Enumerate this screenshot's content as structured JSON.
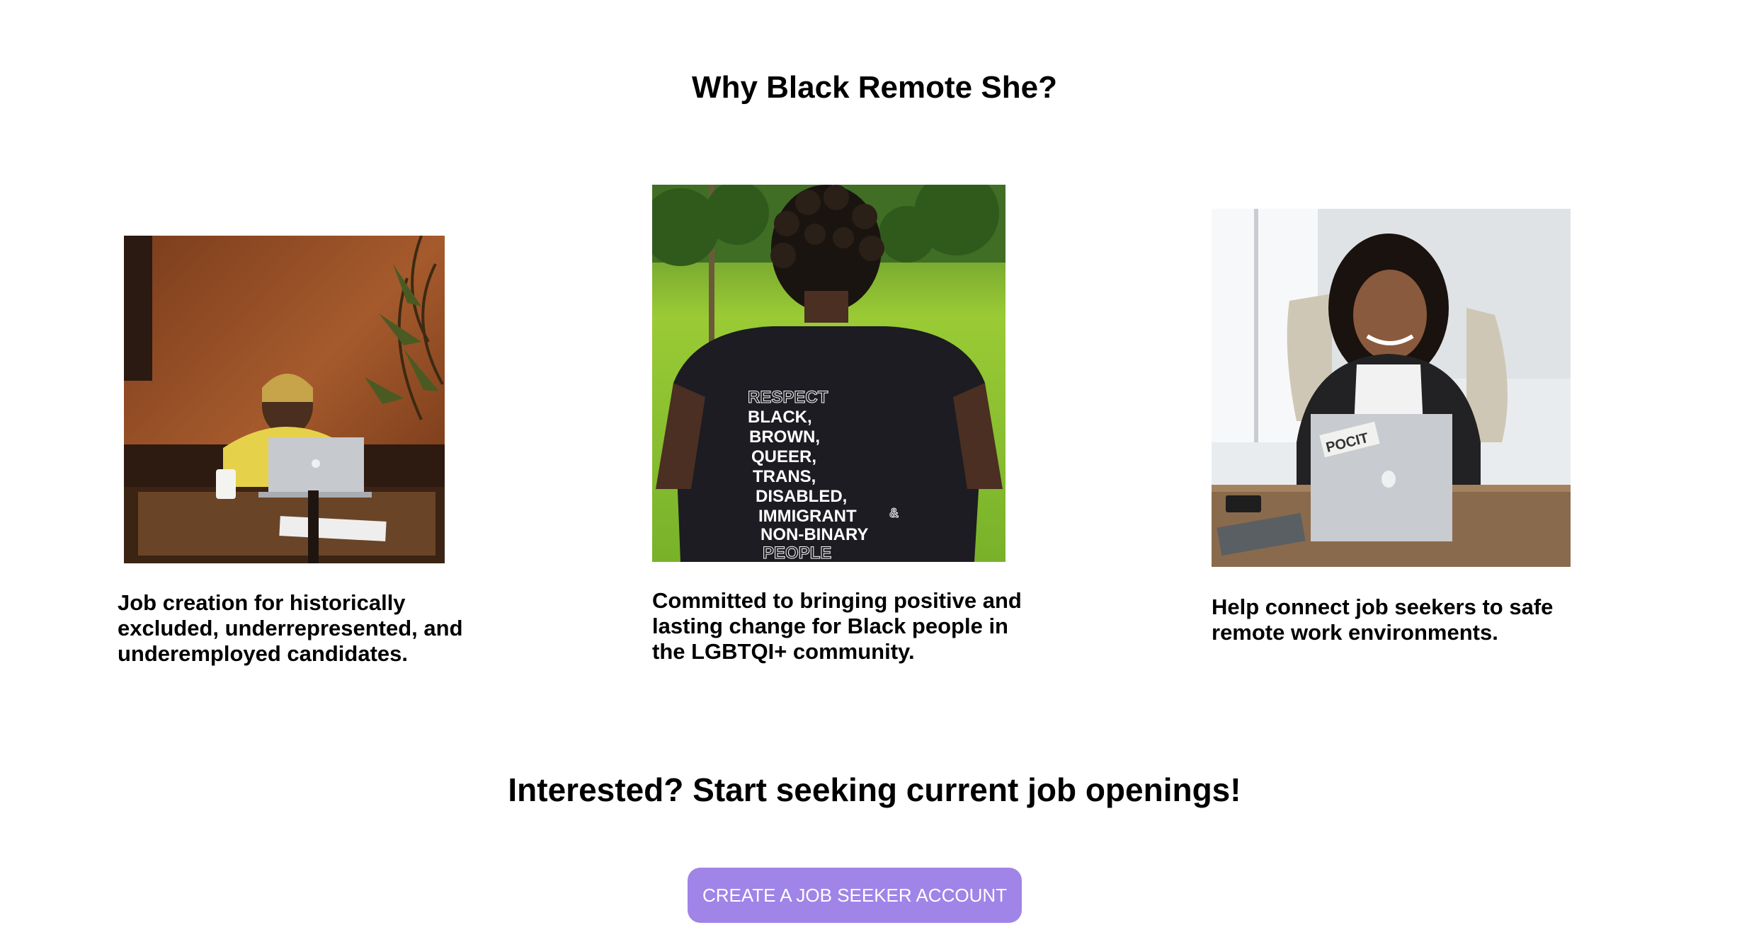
{
  "section": {
    "title": "Why Black Remote She?"
  },
  "features": [
    {
      "caption": "Job creation for historically excluded, underrepresented, and underemployed candidates."
    },
    {
      "caption": "Committed to bringing positive and lasting change for Black people in the LGBTQI+ community.",
      "shirt_text": [
        "RESPECT",
        "BLACK,",
        "BROWN,",
        "QUEER,",
        "TRANS,",
        "DISABLED,",
        "IMMIGRANT",
        "&",
        "NON-BINARY",
        "PEOPLE"
      ]
    },
    {
      "caption": "Help connect job seekers to safe remote work environments.",
      "sticker_text": "POCIT"
    }
  ],
  "cta": {
    "title": "Interested? Start seeking current job openings!",
    "button_label": "CREATE A JOB SEEKER ACCOUNT"
  },
  "colors": {
    "button_bg": "#a084e8",
    "button_text": "#ffffff",
    "text": "#000000",
    "background": "#ffffff"
  }
}
